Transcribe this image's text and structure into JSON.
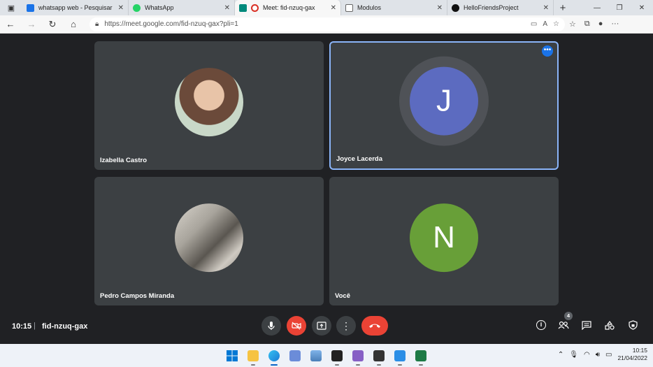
{
  "browser": {
    "tabs": [
      {
        "title": "whatsapp web - Pesquisar",
        "favicon_color": "#1a73e8",
        "active": false
      },
      {
        "title": "WhatsApp",
        "favicon_color": "#25d366",
        "active": false
      },
      {
        "title": "Meet: fid-nzuq-gax",
        "favicon_color": "#00897b",
        "active": true
      },
      {
        "title": "Modulos",
        "favicon_color": "#9e9e9e",
        "active": false
      },
      {
        "title": "HelloFriendsProject",
        "favicon_color": "#111111",
        "active": false
      }
    ],
    "url": "https://meet.google.com/fid-nzuq-gax?pli=1"
  },
  "meet": {
    "participants": [
      {
        "name": "Izabella Castro",
        "avatar_type": "photo"
      },
      {
        "name": "Joyce Lacerda",
        "avatar_type": "initial",
        "initial": "J",
        "color": "#5c6bc0"
      },
      {
        "name": "Pedro Campos Miranda",
        "avatar_type": "photo"
      },
      {
        "name": "Você",
        "avatar_type": "initial",
        "initial": "N",
        "color": "#689f38"
      }
    ],
    "more_options_label": "•••",
    "clock": "10:15",
    "separator": "|",
    "meeting_code": "fid-nzuq-gax",
    "people_count": "4"
  },
  "taskbar": {
    "time": "10:15",
    "date": "21/04/2022"
  }
}
